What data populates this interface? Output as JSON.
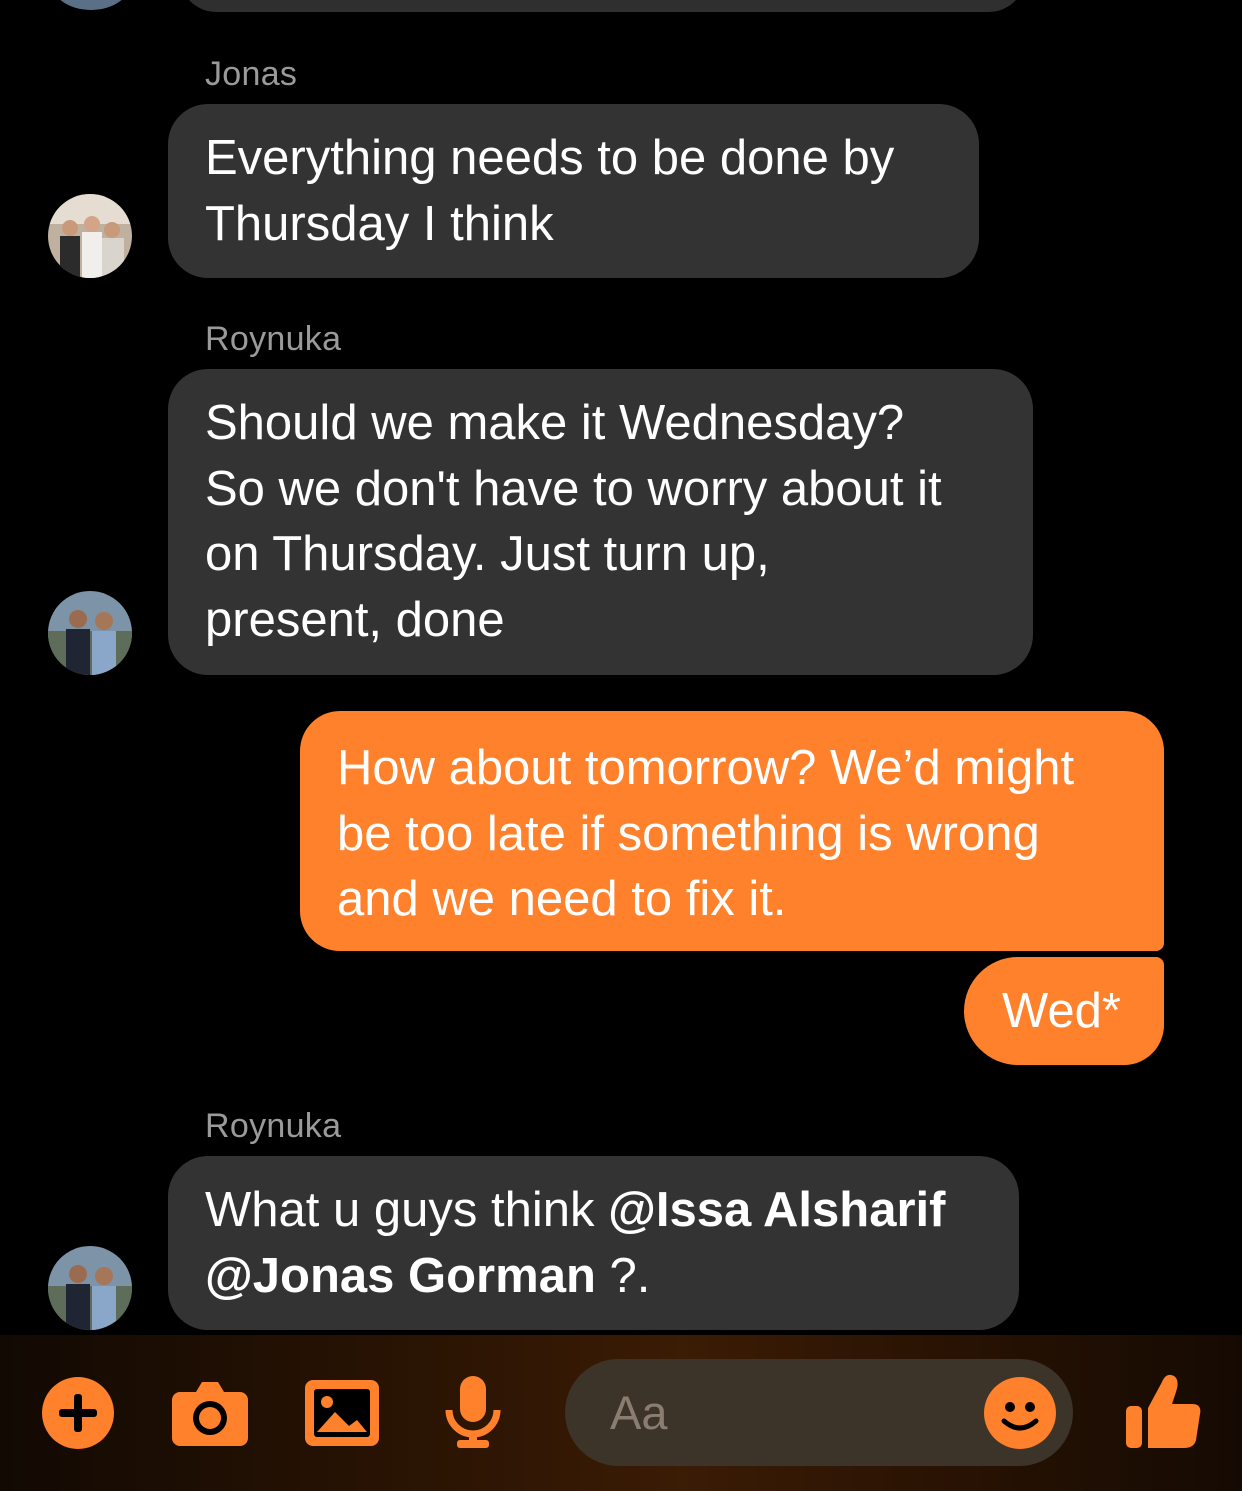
{
  "colors": {
    "accent": "#ff812b",
    "incoming_bubble": "#333333",
    "background": "#000000"
  },
  "messages": [
    {
      "sender": "Jonas",
      "lines": [
        "Everything needs to be done by",
        "Thursday I think"
      ]
    },
    {
      "sender": "Roynuka",
      "lines": [
        "Should we make it Wednesday?",
        "So we don't have to worry about it",
        "on Thursday. Just turn up,",
        "present, done"
      ]
    },
    {
      "own_lines": [
        "How about tomorrow? We’d might",
        "be too late if something is wrong",
        "and we need to fix it."
      ]
    },
    {
      "own_text": "Wed*"
    },
    {
      "sender": "Roynuka",
      "text_start": "What u guys think ",
      "mention1": "@Issa Alsharif",
      "mention2": "@Jonas Gorman",
      "text_end": " ?."
    }
  ],
  "composer": {
    "placeholder": "Aa",
    "icons": [
      "plus-icon",
      "camera-icon",
      "gallery-icon",
      "microphone-icon",
      "emoji-icon",
      "thumbs-up-icon"
    ]
  }
}
